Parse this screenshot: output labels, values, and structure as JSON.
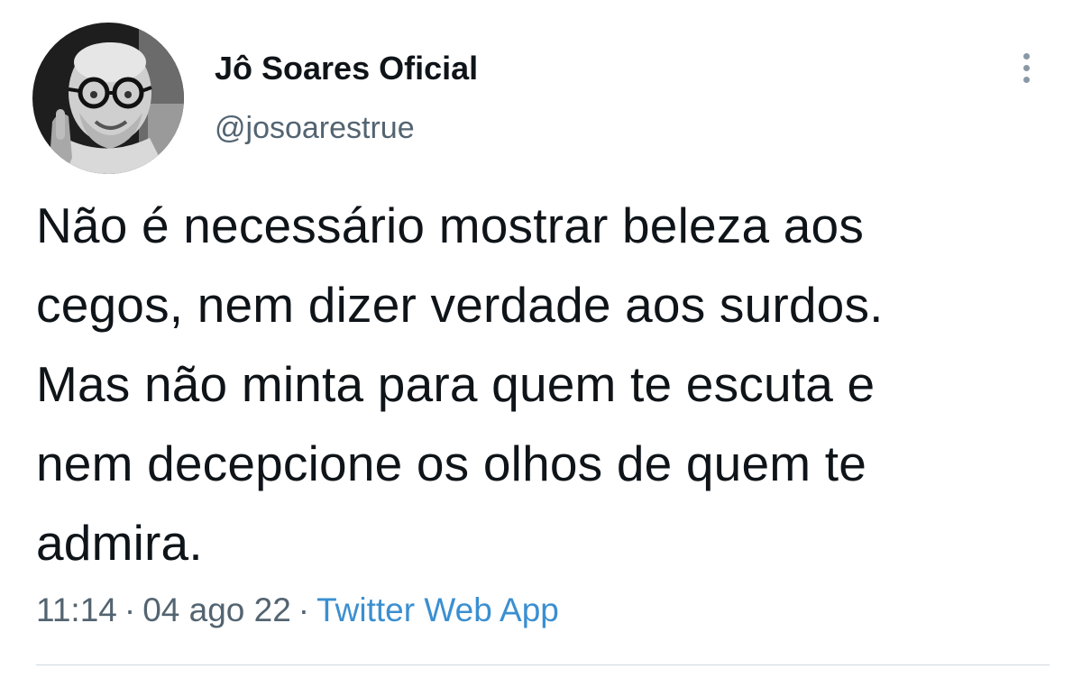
{
  "tweet": {
    "author": {
      "display_name": "Jô Soares Oficial",
      "handle": "@josoarestrue"
    },
    "text_lines": [
      "Não é necessário mostrar beleza aos",
      "cegos, nem dizer verdade aos surdos.",
      "Mas não minta para quem te escuta e",
      "nem decepcione os olhos de quem te",
      "admira."
    ],
    "time": "11:14",
    "date": "04 ago 22",
    "separator": "·",
    "source": "Twitter Web App"
  },
  "icons": {
    "more": "more-vertical-icon",
    "avatar": "profile-photo"
  },
  "colors": {
    "text_primary": "#0f1419",
    "text_secondary": "#536471",
    "link": "#3a8fd1",
    "divider": "#cfd9de"
  }
}
